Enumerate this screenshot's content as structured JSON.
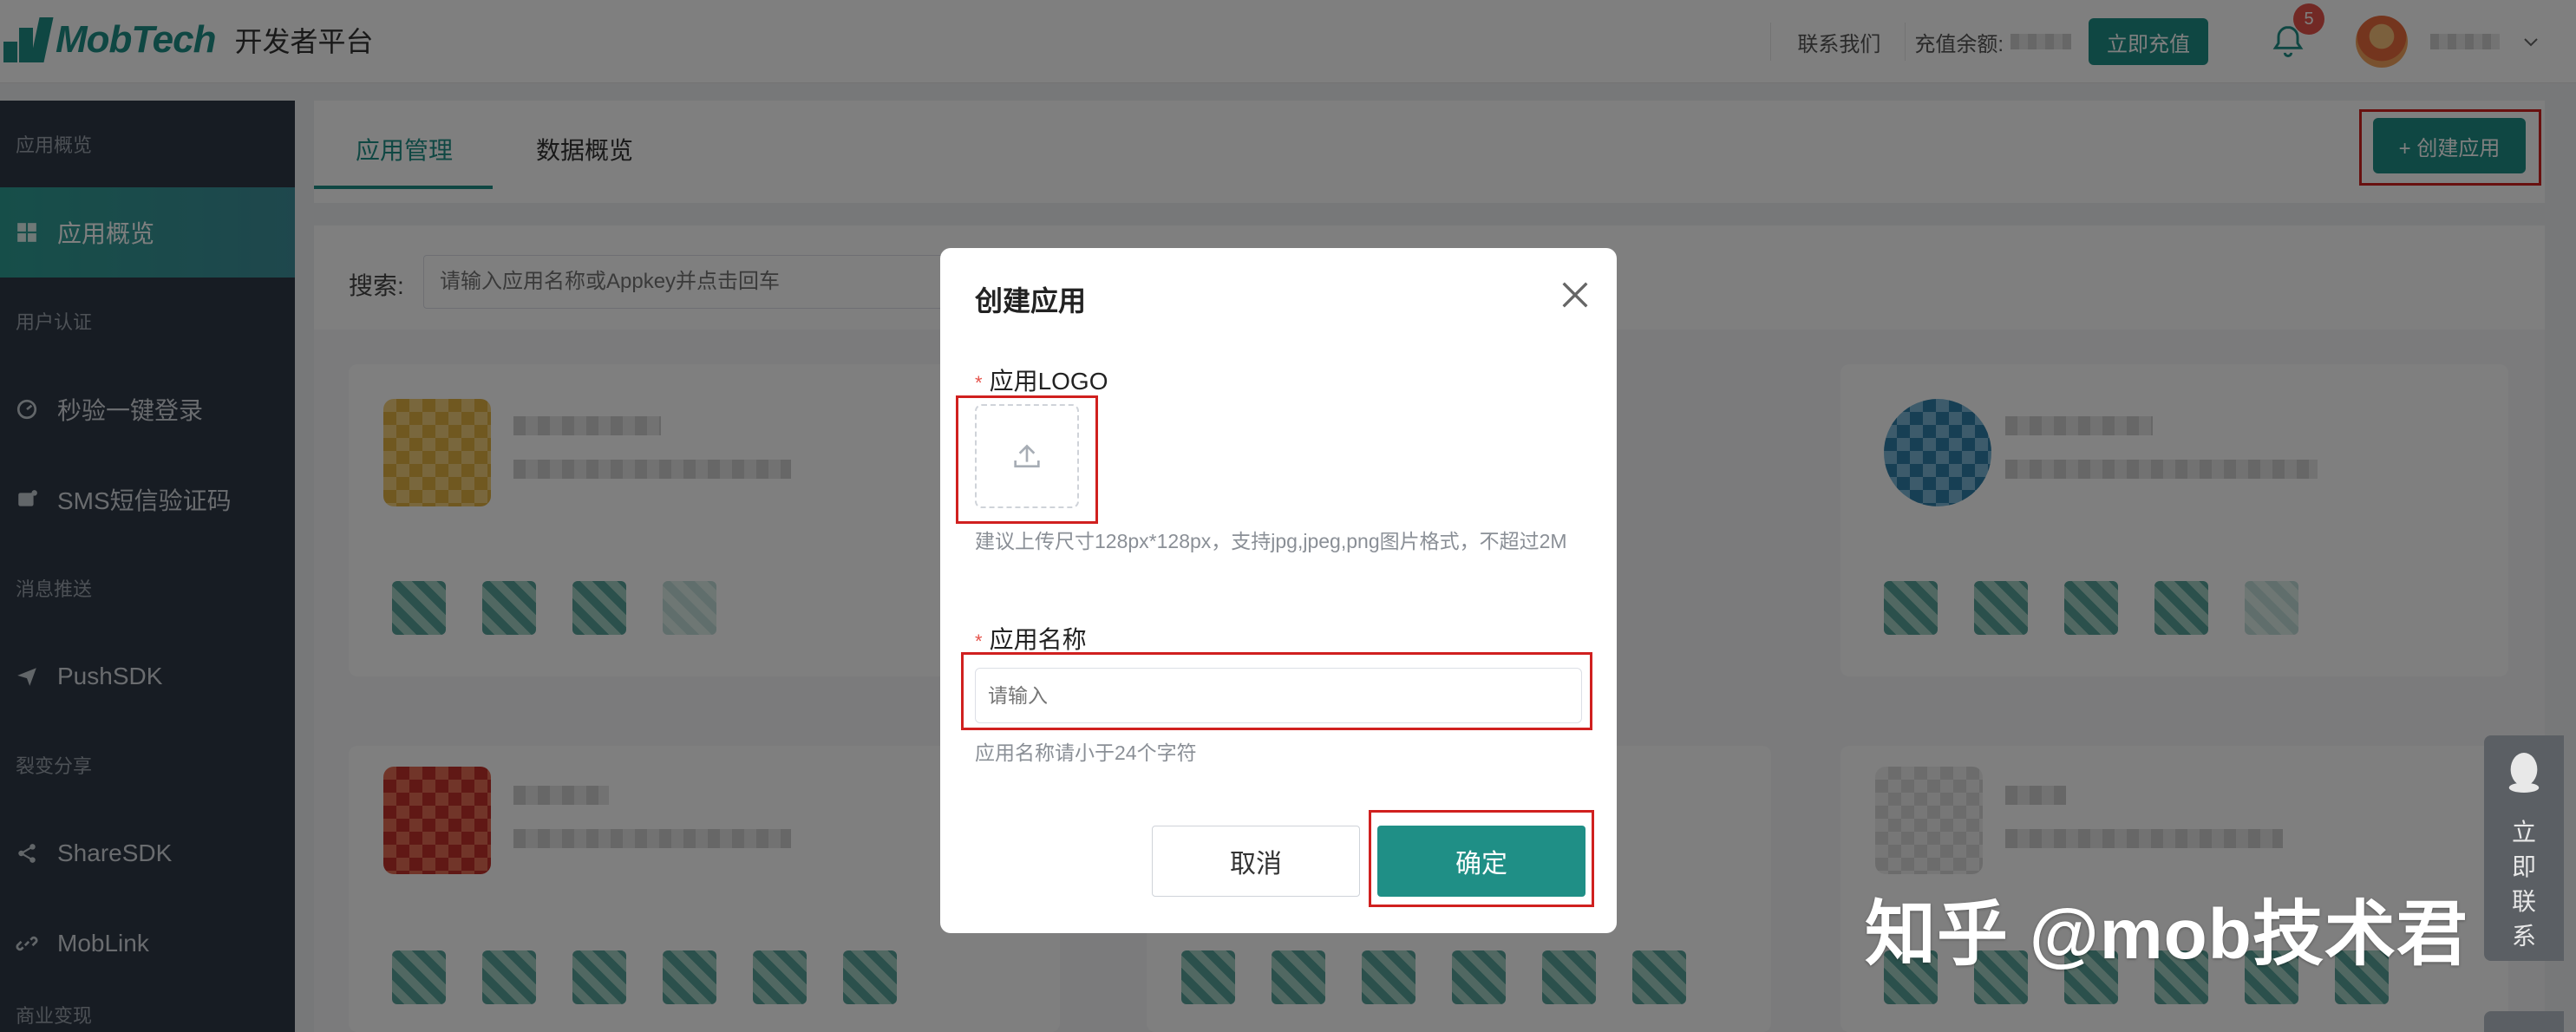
{
  "header": {
    "brand": "MobTech",
    "platform": "开发者平台",
    "contact_link": "联系我们",
    "balance_label": "充值余额:",
    "recharge_button": "立即充值",
    "notification_count": "5"
  },
  "sidebar": {
    "groups": [
      {
        "label": "应用概览",
        "items": [
          {
            "label": "应用概览",
            "active": true
          }
        ]
      },
      {
        "label": "用户认证",
        "items": [
          {
            "label": "秒验一键登录"
          },
          {
            "label": "SMS短信验证码"
          }
        ]
      },
      {
        "label": "消息推送",
        "items": [
          {
            "label": "PushSDK"
          }
        ]
      },
      {
        "label": "裂变分享",
        "items": [
          {
            "label": "ShareSDK"
          },
          {
            "label": "MobLink"
          }
        ]
      },
      {
        "label": "商业变现",
        "items": []
      }
    ]
  },
  "main": {
    "tabs": [
      "应用管理",
      "数据概览"
    ],
    "active_tab": 0,
    "create_button": "+ 创建应用",
    "search_label": "搜索:",
    "search_placeholder": "请输入应用名称或Appkey并点击回车"
  },
  "modal": {
    "title": "创建应用",
    "logo_label": "应用LOGO",
    "logo_hint": "建议上传尺寸128px*128px，支持jpg,jpeg,png图片格式，不超过2M",
    "name_label": "应用名称",
    "name_placeholder": "请输入",
    "name_hint": "应用名称请小于24个字符",
    "cancel_button": "取消",
    "confirm_button": "确定"
  },
  "floating": {
    "contact_text": "立即联系"
  },
  "watermark": "知乎 @mob技术君",
  "colors": {
    "accent": "#1f8f86",
    "sidebar_bg": "#2f3947",
    "highlight": "#d0201f",
    "badge": "#e5534b"
  }
}
